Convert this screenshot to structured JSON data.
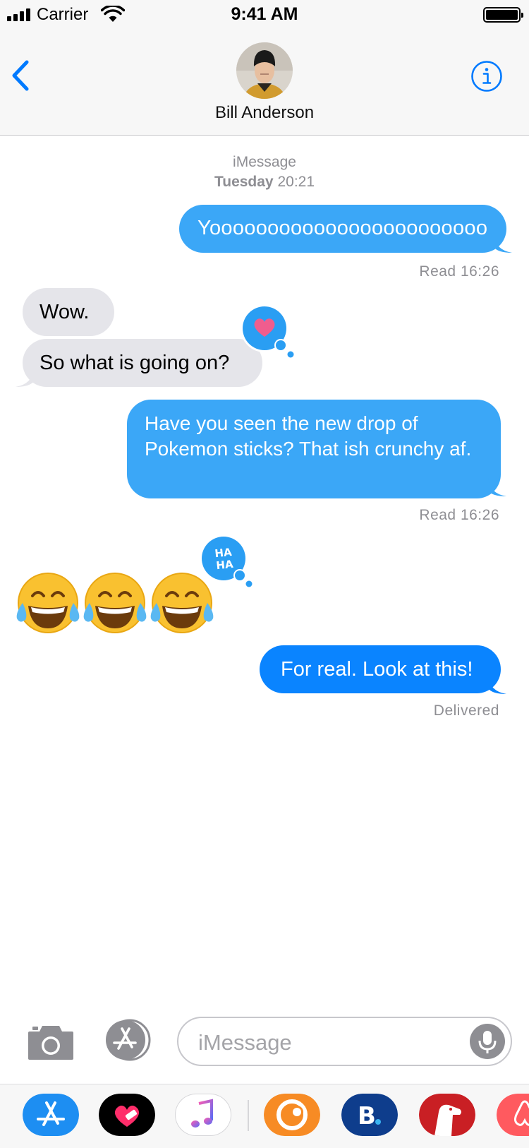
{
  "status_bar": {
    "carrier": "Carrier",
    "time": "9:41 AM"
  },
  "header": {
    "contact_name": "Bill Anderson",
    "avatar_icon": "contact-photo",
    "back_icon": "chevron-left-icon",
    "info_icon": "info-icon"
  },
  "thread": {
    "service": "iMessage",
    "date_day": "Tuesday",
    "date_time": "20:21",
    "messages": [
      {
        "direction": "outgoing",
        "text": "Yoooooooooooooooooooooooo"
      },
      {
        "direction": "incoming",
        "text": "Wow."
      },
      {
        "direction": "incoming",
        "text": "So what is going on?",
        "tapback": "heart"
      },
      {
        "direction": "outgoing",
        "text": "Have you seen the new drop of Pokemon sticks? That ish crunchy af."
      },
      {
        "direction": "incoming",
        "text": "😂😂😂",
        "tapback": "haha"
      },
      {
        "direction": "outgoing",
        "text": "For real. Look at this!"
      }
    ],
    "receipts": [
      "Read 16:26",
      "Read 16:26",
      "Delivered"
    ],
    "tapback_haha_text": "HA HA"
  },
  "input_bar": {
    "placeholder": "iMessage",
    "camera_icon": "camera-icon",
    "apps_icon": "app-store-icon",
    "mic_icon": "microphone-icon"
  },
  "app_drawer": {
    "apps": [
      "App Store",
      "Digital Touch",
      "Music",
      "Crunchyroll",
      "Booking.com",
      "Puppy",
      "Airbnb"
    ]
  },
  "colors": {
    "outgoing_bubble": "#3ba7f7",
    "outgoing_bubble_latest": "#0a84ff",
    "incoming_bubble": "#e5e5ea",
    "accent": "#007aff",
    "meta_text": "#8e8e93"
  }
}
